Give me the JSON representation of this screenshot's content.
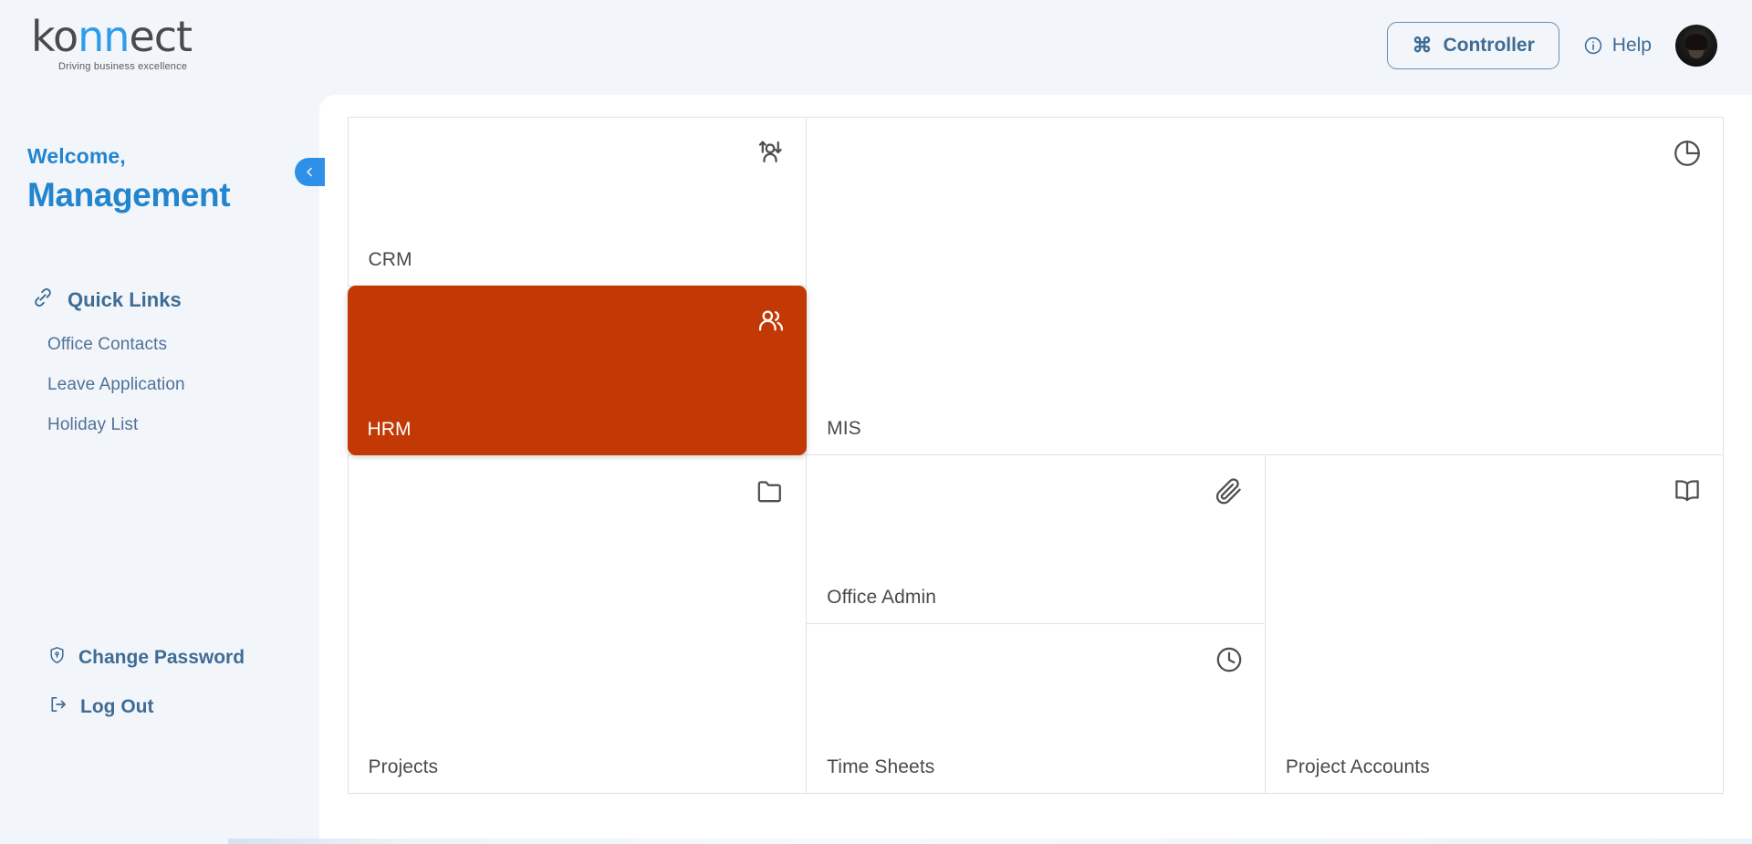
{
  "brand": {
    "name_part1": "ko",
    "name_accent": "nn",
    "name_part2": "ect",
    "tagline": "Driving business excellence"
  },
  "header": {
    "controller_label": "Controller",
    "controller_glyph": "⌘",
    "help_label": "Help",
    "icons": {
      "command": "command-icon",
      "info": "info-icon",
      "avatar": "user-avatar"
    }
  },
  "sidebar": {
    "welcome_small": "Welcome,",
    "welcome_name": "Management",
    "quick_links_title": "Quick Links",
    "quick_links": [
      {
        "label": "Office Contacts"
      },
      {
        "label": "Leave Application"
      },
      {
        "label": "Holiday List"
      }
    ],
    "change_password_label": "Change Password",
    "logout_label": "Log Out",
    "collapse_tooltip": "Collapse sidebar"
  },
  "modules": [
    {
      "label": "CRM",
      "icon": "user-transfer-icon",
      "active": false
    },
    {
      "label": "MIS",
      "icon": "pie-chart-icon",
      "active": false
    },
    {
      "label": "HRM",
      "icon": "users-icon",
      "active": true
    },
    {
      "label": "Office Admin",
      "icon": "paperclip-icon",
      "active": false
    },
    {
      "label": "Projects",
      "icon": "folder-icon",
      "active": false
    },
    {
      "label": "Time Sheets",
      "icon": "clock-icon",
      "active": false
    },
    {
      "label": "Project Accounts",
      "icon": "book-icon",
      "active": false
    }
  ],
  "colors": {
    "background": "#f2f6fb",
    "panel": "#ffffff",
    "brand_blue": "#2285ce",
    "link_blue": "#3f6c95",
    "accent_orange": "#c23906",
    "tile_border": "#e2e2e2"
  }
}
